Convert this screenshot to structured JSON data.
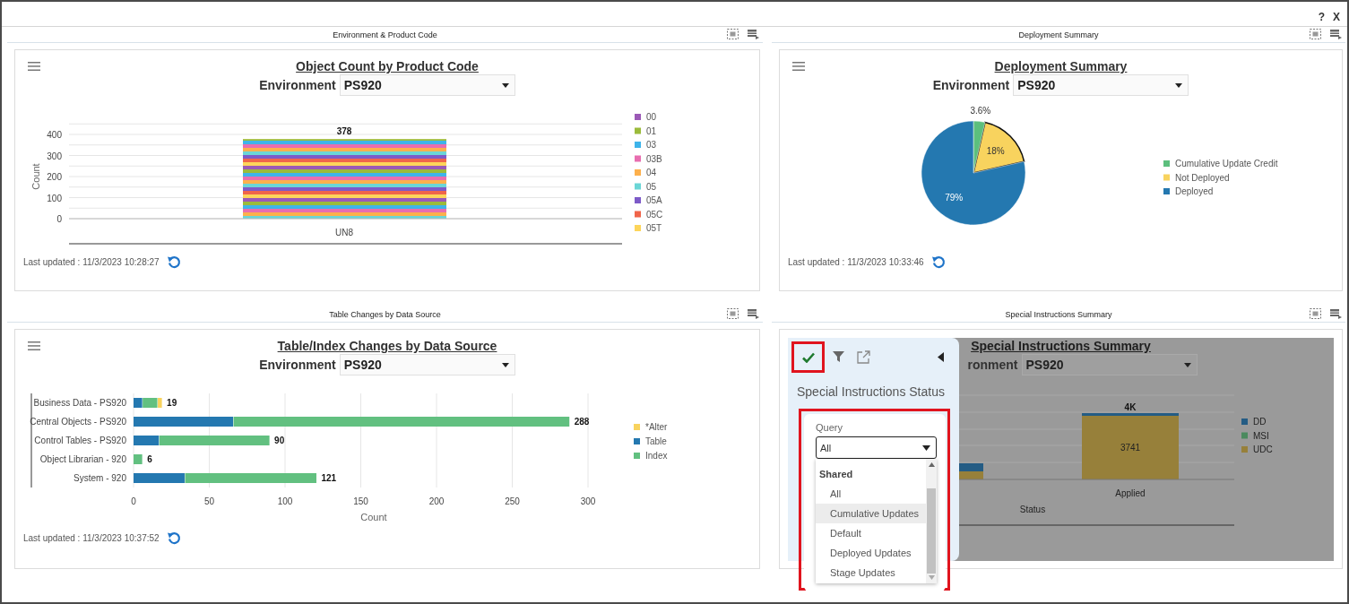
{
  "window": {
    "help_label": "?",
    "close_label": "X"
  },
  "panels": [
    {
      "kind": "column",
      "header": "Environment & Product Code",
      "title": "Object Count by Product Code",
      "environment": {
        "label": "Environment",
        "value": "PS920"
      },
      "chart_data": {
        "type": "bar",
        "stacked": true,
        "ylabel": "Count",
        "categories": [
          "UN8"
        ],
        "values": [
          378
        ],
        "ylim": [
          0,
          450
        ],
        "yticks": [
          0,
          100,
          200,
          300,
          400
        ],
        "grid": true,
        "data_labels": true
      },
      "legend": [
        {
          "name": "00",
          "color": "#9b59b6"
        },
        {
          "name": "01",
          "color": "#9bbb3b"
        },
        {
          "name": "03",
          "color": "#3eb4ea"
        },
        {
          "name": "03B",
          "color": "#e86eb0"
        },
        {
          "name": "04",
          "color": "#fdb04c"
        },
        {
          "name": "05",
          "color": "#6bd6d6"
        },
        {
          "name": "05A",
          "color": "#7d5ac8"
        },
        {
          "name": "05C",
          "color": "#f0654a"
        },
        {
          "name": "05T",
          "color": "#fdd55a"
        }
      ],
      "last_updated": "Last updated : 11/3/2023 10:28:27"
    },
    {
      "kind": "pie",
      "header": "Deployment Summary",
      "title": "Deployment Summary",
      "environment": {
        "label": "Environment",
        "value": "PS920"
      },
      "chart_data": {
        "type": "pie",
        "categories": [
          "Cumulative Update Credit",
          "Not Deployed",
          "Deployed"
        ],
        "values": [
          3.6,
          18,
          79
        ],
        "value_labels": [
          "3.6%",
          "18%",
          "79%"
        ],
        "legend": "right"
      },
      "slices": [
        {
          "color": "#5cbf7d",
          "selected": false
        },
        {
          "color": "#f8d35e",
          "selected": true
        },
        {
          "color": "#2478b0",
          "selected": false
        }
      ],
      "last_updated": "Last updated : 11/3/2023 10:33:46"
    },
    {
      "kind": "hbar",
      "header": "Table Changes by Data Source",
      "title": "Table/Index Changes by Data Source",
      "environment": {
        "label": "Environment",
        "value": "PS920"
      },
      "chart_data": {
        "type": "bar",
        "orientation": "horizontal",
        "stacked": true,
        "xlabel": "Count",
        "categories": [
          "Business Data - PS920",
          "Central Objects - PS920",
          "Control Tables - PS920",
          "Object Librarian - 920",
          "System - 920"
        ],
        "series": [
          {
            "name": "*Alter",
            "color": "#f8d35e",
            "values": [
              3,
              0,
              0,
              0,
              0
            ]
          },
          {
            "name": "Table",
            "color": "#2478b0",
            "values": [
              6,
              66,
              17,
              0,
              34
            ]
          },
          {
            "name": "Index",
            "color": "#62c080",
            "values": [
              10,
              222,
              73,
              6,
              87
            ]
          }
        ],
        "xlim": [
          0,
          300
        ],
        "xticks": [
          0,
          50,
          100,
          150,
          200,
          250,
          300
        ],
        "grid": true,
        "value_labels": [
          "19",
          "288",
          "90",
          "6",
          "121"
        ],
        "legend": "right"
      },
      "last_updated": "Last updated : 11/3/2023 10:37:52"
    },
    {
      "kind": "overlay",
      "header": "Special Instructions Summary",
      "title": "Special Instructions Summary",
      "environment": {
        "label": "ronment",
        "value": "PS920"
      },
      "background_chart": {
        "total_label": "4K",
        "value_label": "3741",
        "category": "Applied",
        "xlabel": "Status",
        "legend": [
          {
            "name": "DD",
            "color": "#245c84"
          },
          {
            "name": "MSI",
            "color": "#4b8a5e"
          },
          {
            "name": "UDC",
            "color": "#97803a"
          }
        ]
      },
      "side_panel": {
        "title": "Special Instructions Status",
        "query": {
          "label": "Query",
          "value": "All"
        },
        "group": "Shared",
        "options": [
          {
            "label": "All",
            "selected": false
          },
          {
            "label": "Cumulative Updates",
            "selected": true
          },
          {
            "label": "Default",
            "selected": false
          },
          {
            "label": "Deployed Updates",
            "selected": false
          },
          {
            "label": "Stage Updates",
            "selected": false
          }
        ]
      }
    }
  ]
}
